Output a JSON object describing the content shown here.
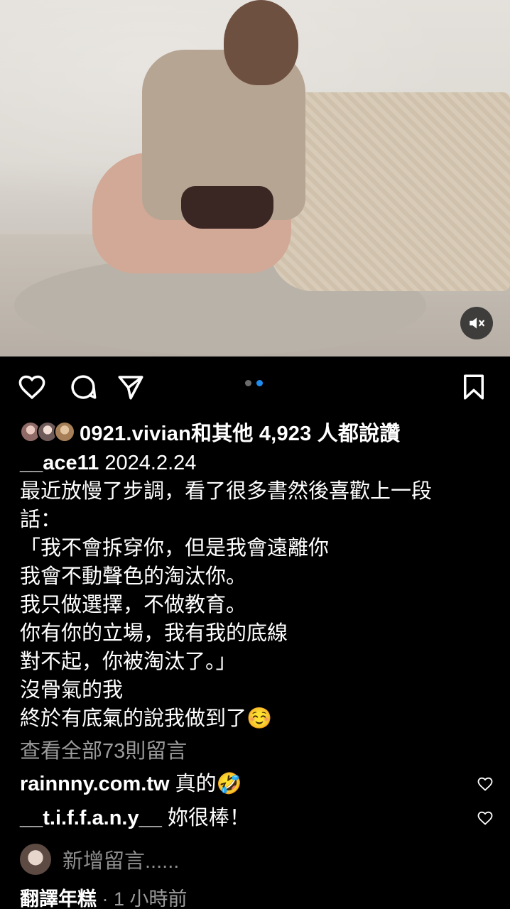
{
  "post": {
    "media_icons": {
      "mute": "speaker-muted-icon"
    },
    "carousel": {
      "count": 2,
      "active_index": 1
    },
    "actions": {
      "like": "heart-icon",
      "comment": "comment-bubble-icon",
      "share": "paper-plane-icon",
      "save": "bookmark-icon"
    },
    "likes": {
      "prefix_user": "0921.vivian",
      "text": "和其他 4,923 人都說讚"
    },
    "caption": {
      "username": "__ace11",
      "date": "2024.2.24",
      "lines": [
        "最近放慢了步調，看了很多書然後喜歡上一段",
        "話：",
        "「我不會拆穿你，但是我會遠離你",
        "我會不動聲色的淘汰你。",
        "我只做選擇，不做教育。",
        "你有你的立場，我有我的底線",
        "對不起，你被淘汰了。」",
        "沒骨氣的我",
        "終於有底氣的說我做到了☺️"
      ]
    },
    "view_all_comments": "查看全部73則留言",
    "comments": [
      {
        "user": "rainnny.com.tw",
        "text": "真的🤣"
      },
      {
        "user": "__t.i.f.f.a.n.y__",
        "text": "妳很棒！"
      }
    ],
    "add_comment_placeholder": "新增留言......",
    "footer": {
      "user": "翻譯年糕",
      "time": "· 1 小時前"
    }
  }
}
